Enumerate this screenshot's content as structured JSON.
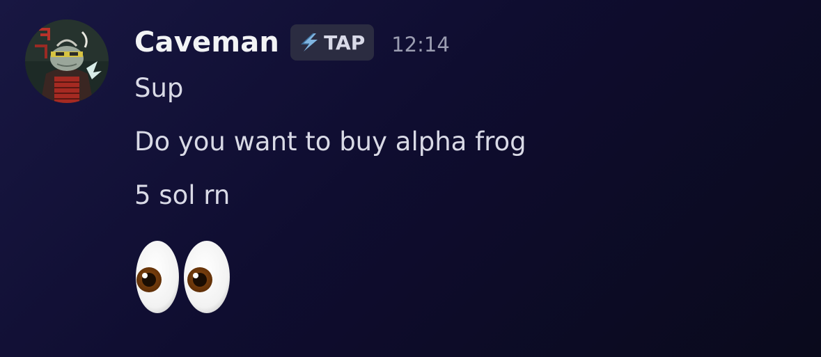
{
  "message": {
    "author": {
      "username": "Caveman",
      "avatar_icon": "frog-samurai-avatar",
      "badge": {
        "icon": "lightning-bolt-icon",
        "label": "TAP"
      }
    },
    "timestamp": "12:14",
    "lines": [
      "Sup",
      "Do you want to buy alpha frog",
      "5 sol rn"
    ],
    "emoji": "eyes-emoji"
  },
  "colors": {
    "background_top": "#181742",
    "background_bottom": "#0a0a1c",
    "username": "#f2f3f5",
    "message_text": "#d9dae6",
    "timestamp": "#9b9db1",
    "badge_bg": "#2b2c41",
    "badge_icon": "#7fb4e0"
  }
}
